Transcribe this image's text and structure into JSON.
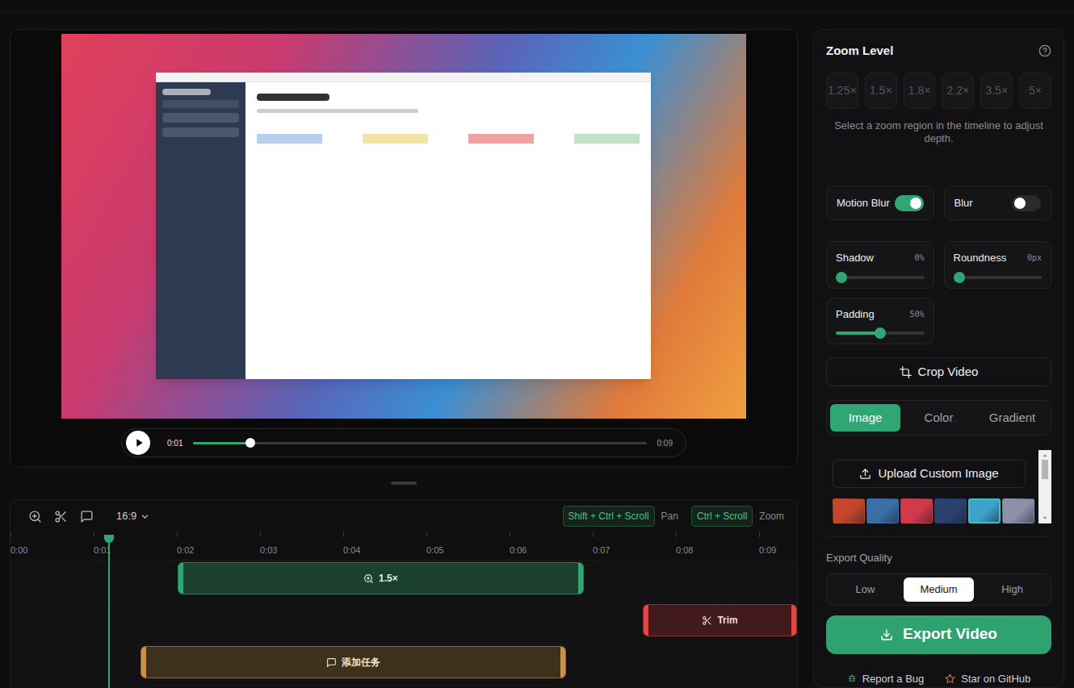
{
  "preview": {
    "playing": false,
    "time_current": "0:01",
    "time_total": "0:09",
    "level": 0.126
  },
  "timeline": {
    "aspect": "16:9",
    "shortcuts": [
      {
        "keys": "Shift + Ctrl + Scroll",
        "action": "Pan"
      },
      {
        "keys": "Ctrl + Scroll",
        "action": "Zoom"
      }
    ],
    "ticks": [
      "0:00",
      "0:01",
      "0:02",
      "0:03",
      "0:04",
      "0:05",
      "0:06",
      "0:07",
      "0:08",
      "0:09"
    ],
    "playhead": 1.18,
    "segments": [
      {
        "kind": "zoom",
        "label": "1.5×",
        "start": 2.01,
        "end": 6.89
      },
      {
        "kind": "trim",
        "label": "Trim",
        "start": 7.6,
        "end": 9.46
      },
      {
        "kind": "annotation",
        "label": "添加任务",
        "start": 1.56,
        "end": 6.68
      }
    ]
  },
  "settings": {
    "zoom": {
      "title": "Zoom Level",
      "options": [
        {
          "label": "1.25×",
          "disabled": true
        },
        {
          "label": "1.5×",
          "disabled": true
        },
        {
          "label": "1.8×",
          "disabled": true
        },
        {
          "label": "2.2×",
          "disabled": true
        },
        {
          "label": "3.5×",
          "disabled": true
        },
        {
          "label": "5×",
          "disabled": true
        }
      ],
      "hint": "Select a zoom region in the timeline to adjust depth."
    },
    "toggles": [
      {
        "label": "Motion Blur",
        "on": true
      },
      {
        "label": "Blur",
        "on": false
      }
    ],
    "sliders": [
      {
        "label": "Shadow",
        "reading": "0%",
        "level": 0
      },
      {
        "label": "Roundness",
        "reading": "0px",
        "level": 0
      },
      {
        "label": "Padding",
        "reading": "50%",
        "level": 0.5
      }
    ],
    "crop_button": "Crop Video",
    "background_tabs": [
      {
        "label": "Image",
        "selected": true
      },
      {
        "label": "Color",
        "selected": false
      },
      {
        "label": "Gradient",
        "selected": false
      }
    ],
    "upload_button": "Upload Custom Image",
    "wallpapers": [
      {
        "color": "#c4462c",
        "selected": false
      },
      {
        "color": "#3c6fa8",
        "selected": false
      },
      {
        "color": "#d23a4c",
        "selected": false
      },
      {
        "color": "#2b4270",
        "selected": false
      },
      {
        "color": "#3aa2cc",
        "selected": true
      },
      {
        "color": "#8d90a8",
        "selected": false
      }
    ],
    "wallpaper_scroll": 0,
    "export_quality": {
      "label": "Export Quality",
      "options": [
        {
          "label": "Low",
          "selected": false
        },
        {
          "label": "Medium",
          "selected": true
        },
        {
          "label": "High",
          "selected": false
        }
      ]
    },
    "export_button": "Export Video",
    "footer": [
      {
        "kind": "bug",
        "label": "Report a Bug"
      },
      {
        "kind": "star",
        "label": "Star on GitHub"
      }
    ]
  }
}
